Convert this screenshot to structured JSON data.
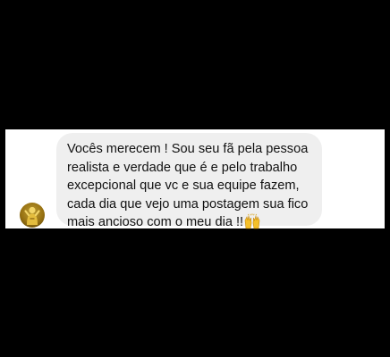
{
  "message": {
    "lines": [
      "Vocês merecem ! Sou seu fã pela pessoa",
      "realista e verdade que é e pelo trabalho",
      "excepcional que vc e sua equipe fazem,",
      "cada dia que vejo uma postagem sua fico",
      "mais ancioso com o meu dia !!"
    ],
    "emoji": "raising-hands-emoji"
  },
  "avatar": {
    "icon": "profile-avatar-gold-figure"
  },
  "colors": {
    "background": "#000000",
    "panel": "#ffffff",
    "bubble": "#efefef",
    "text": "#111111",
    "avatar_gold": "#c9a227"
  }
}
